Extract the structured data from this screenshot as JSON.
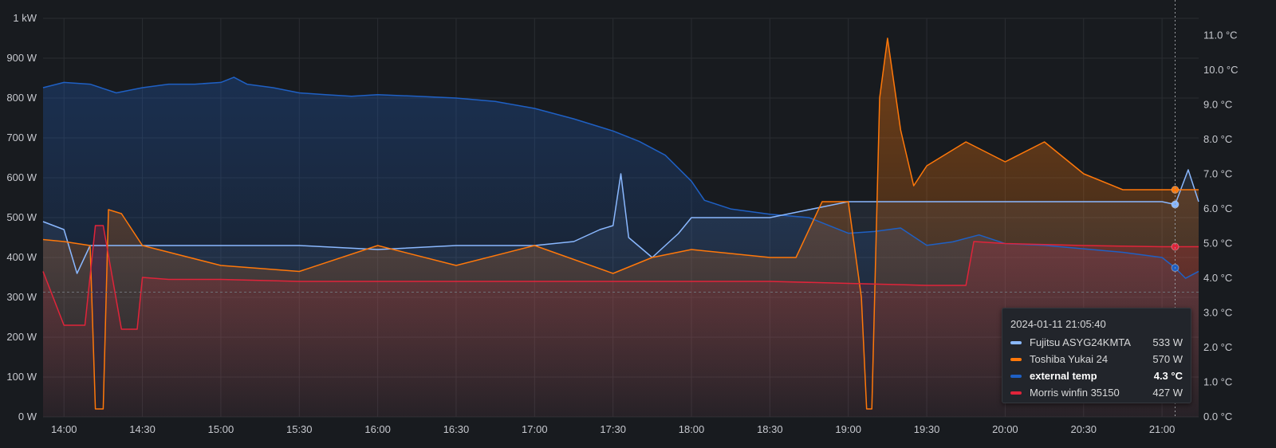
{
  "chart_data": {
    "type": "line",
    "x_ticks": [
      "14:00",
      "14:30",
      "15:00",
      "15:30",
      "16:00",
      "16:30",
      "17:00",
      "17:30",
      "18:00",
      "18:30",
      "19:00",
      "19:30",
      "20:00",
      "20:30",
      "21:00"
    ],
    "y_left_ticks": [
      "0 W",
      "100 W",
      "200 W",
      "300 W",
      "400 W",
      "500 W",
      "600 W",
      "700 W",
      "800 W",
      "900 W",
      "1 kW"
    ],
    "y_right_ticks": [
      "0.0 °C",
      "1.0 °C",
      "2.0 °C",
      "3.0 °C",
      "4.0 °C",
      "5.0 °C",
      "6.0 °C",
      "7.0 °C",
      "8.0 °C",
      "9.0 °C",
      "10.0 °C",
      "11.0 °C"
    ],
    "ylim_left": [
      0,
      1000
    ],
    "ylim_right": [
      0,
      11.5
    ],
    "x_range": [
      "13:52",
      "21:14"
    ],
    "series": [
      {
        "name": "external temp",
        "unit": "°C",
        "axis": "right",
        "color": "#1f60c4",
        "points": [
          [
            "13:52",
            9.5
          ],
          [
            "14:00",
            9.65
          ],
          [
            "14:10",
            9.6
          ],
          [
            "14:20",
            9.35
          ],
          [
            "14:30",
            9.5
          ],
          [
            "14:40",
            9.6
          ],
          [
            "14:50",
            9.6
          ],
          [
            "15:00",
            9.65
          ],
          [
            "15:05",
            9.8
          ],
          [
            "15:10",
            9.6
          ],
          [
            "15:20",
            9.5
          ],
          [
            "15:30",
            9.35
          ],
          [
            "15:40",
            9.3
          ],
          [
            "15:50",
            9.25
          ],
          [
            "16:00",
            9.3
          ],
          [
            "16:15",
            9.25
          ],
          [
            "16:30",
            9.2
          ],
          [
            "16:45",
            9.1
          ],
          [
            "17:00",
            8.9
          ],
          [
            "17:15",
            8.6
          ],
          [
            "17:30",
            8.25
          ],
          [
            "17:40",
            7.95
          ],
          [
            "17:50",
            7.55
          ],
          [
            "18:00",
            6.8
          ],
          [
            "18:05",
            6.25
          ],
          [
            "18:15",
            6.0
          ],
          [
            "18:30",
            5.85
          ],
          [
            "18:45",
            5.75
          ],
          [
            "19:00",
            5.3
          ],
          [
            "19:10",
            5.35
          ],
          [
            "19:20",
            5.45
          ],
          [
            "19:30",
            4.95
          ],
          [
            "19:40",
            5.05
          ],
          [
            "19:50",
            5.25
          ],
          [
            "20:00",
            5.0
          ],
          [
            "20:15",
            4.95
          ],
          [
            "20:30",
            4.85
          ],
          [
            "20:45",
            4.75
          ],
          [
            "21:00",
            4.6
          ],
          [
            "21:05",
            4.3
          ],
          [
            "21:09",
            4.0
          ],
          [
            "21:14",
            4.2
          ]
        ]
      },
      {
        "name": "Fujitsu ASYG24KMTA",
        "unit": "W",
        "axis": "left",
        "color": "#8ab8ff",
        "points": [
          [
            "13:52",
            490
          ],
          [
            "14:00",
            470
          ],
          [
            "14:05",
            360
          ],
          [
            "14:10",
            430
          ],
          [
            "14:20",
            430
          ],
          [
            "14:30",
            430
          ],
          [
            "14:40",
            430
          ],
          [
            "15:00",
            430
          ],
          [
            "15:30",
            430
          ],
          [
            "16:00",
            420
          ],
          [
            "16:30",
            430
          ],
          [
            "17:00",
            430
          ],
          [
            "17:15",
            440
          ],
          [
            "17:25",
            470
          ],
          [
            "17:30",
            480
          ],
          [
            "17:33",
            610
          ],
          [
            "17:36",
            450
          ],
          [
            "17:45",
            400
          ],
          [
            "17:55",
            460
          ],
          [
            "18:00",
            500
          ],
          [
            "18:10",
            500
          ],
          [
            "18:30",
            500
          ],
          [
            "18:45",
            520
          ],
          [
            "19:00",
            540
          ],
          [
            "19:30",
            540
          ],
          [
            "20:00",
            540
          ],
          [
            "20:30",
            540
          ],
          [
            "21:00",
            540
          ],
          [
            "21:05",
            533
          ],
          [
            "21:10",
            620
          ],
          [
            "21:14",
            540
          ]
        ]
      },
      {
        "name": "Toshiba Yukai 24",
        "unit": "W",
        "axis": "left",
        "color": "#ff780a",
        "points": [
          [
            "13:52",
            445
          ],
          [
            "14:00",
            440
          ],
          [
            "14:10",
            430
          ],
          [
            "14:12",
            20
          ],
          [
            "14:15",
            20
          ],
          [
            "14:17",
            520
          ],
          [
            "14:22",
            510
          ],
          [
            "14:30",
            430
          ],
          [
            "15:00",
            380
          ],
          [
            "15:30",
            365
          ],
          [
            "16:00",
            430
          ],
          [
            "16:30",
            380
          ],
          [
            "17:00",
            430
          ],
          [
            "17:30",
            360
          ],
          [
            "17:45",
            400
          ],
          [
            "18:00",
            420
          ],
          [
            "18:15",
            410
          ],
          [
            "18:30",
            400
          ],
          [
            "18:40",
            400
          ],
          [
            "18:50",
            540
          ],
          [
            "19:00",
            540
          ],
          [
            "19:05",
            300
          ],
          [
            "19:07",
            20
          ],
          [
            "19:09",
            20
          ],
          [
            "19:12",
            800
          ],
          [
            "19:15",
            950
          ],
          [
            "19:20",
            720
          ],
          [
            "19:25",
            580
          ],
          [
            "19:30",
            630
          ],
          [
            "19:45",
            690
          ],
          [
            "20:00",
            640
          ],
          [
            "20:15",
            690
          ],
          [
            "20:30",
            610
          ],
          [
            "20:45",
            570
          ],
          [
            "21:00",
            570
          ],
          [
            "21:05",
            570
          ],
          [
            "21:14",
            570
          ]
        ]
      },
      {
        "name": "Morris winfin 35150",
        "unit": "W",
        "axis": "left",
        "color": "#e0243a",
        "points": [
          [
            "13:52",
            365
          ],
          [
            "14:00",
            230
          ],
          [
            "14:08",
            230
          ],
          [
            "14:12",
            480
          ],
          [
            "14:15",
            480
          ],
          [
            "14:22",
            220
          ],
          [
            "14:28",
            220
          ],
          [
            "14:30",
            350
          ],
          [
            "14:40",
            345
          ],
          [
            "15:00",
            345
          ],
          [
            "15:30",
            340
          ],
          [
            "16:00",
            340
          ],
          [
            "16:30",
            340
          ],
          [
            "17:00",
            340
          ],
          [
            "17:30",
            340
          ],
          [
            "18:00",
            340
          ],
          [
            "18:30",
            340
          ],
          [
            "19:00",
            335
          ],
          [
            "19:30",
            330
          ],
          [
            "19:45",
            330
          ],
          [
            "19:48",
            440
          ],
          [
            "20:00",
            435
          ],
          [
            "20:30",
            430
          ],
          [
            "21:00",
            427
          ],
          [
            "21:14",
            427
          ]
        ]
      }
    ],
    "cursor_time": "21:05",
    "threshold_line_value": 313
  },
  "tooltip": {
    "time": "2024-01-11 21:05:40",
    "rows": [
      {
        "name": "Fujitsu ASYG24KMTA",
        "value": "533 W",
        "color": "#8ab8ff",
        "bold": false
      },
      {
        "name": "Toshiba Yukai 24",
        "value": "570 W",
        "color": "#ff780a",
        "bold": false
      },
      {
        "name": "external temp",
        "value": "4.3 °C",
        "color": "#1f60c4",
        "bold": true
      },
      {
        "name": "Morris winfin 35150",
        "value": "427 W",
        "color": "#e0243a",
        "bold": false
      }
    ]
  },
  "colors": {
    "background": "#181b1f",
    "grid": "#2a2d32",
    "tick_text": "#c7c9cf"
  }
}
